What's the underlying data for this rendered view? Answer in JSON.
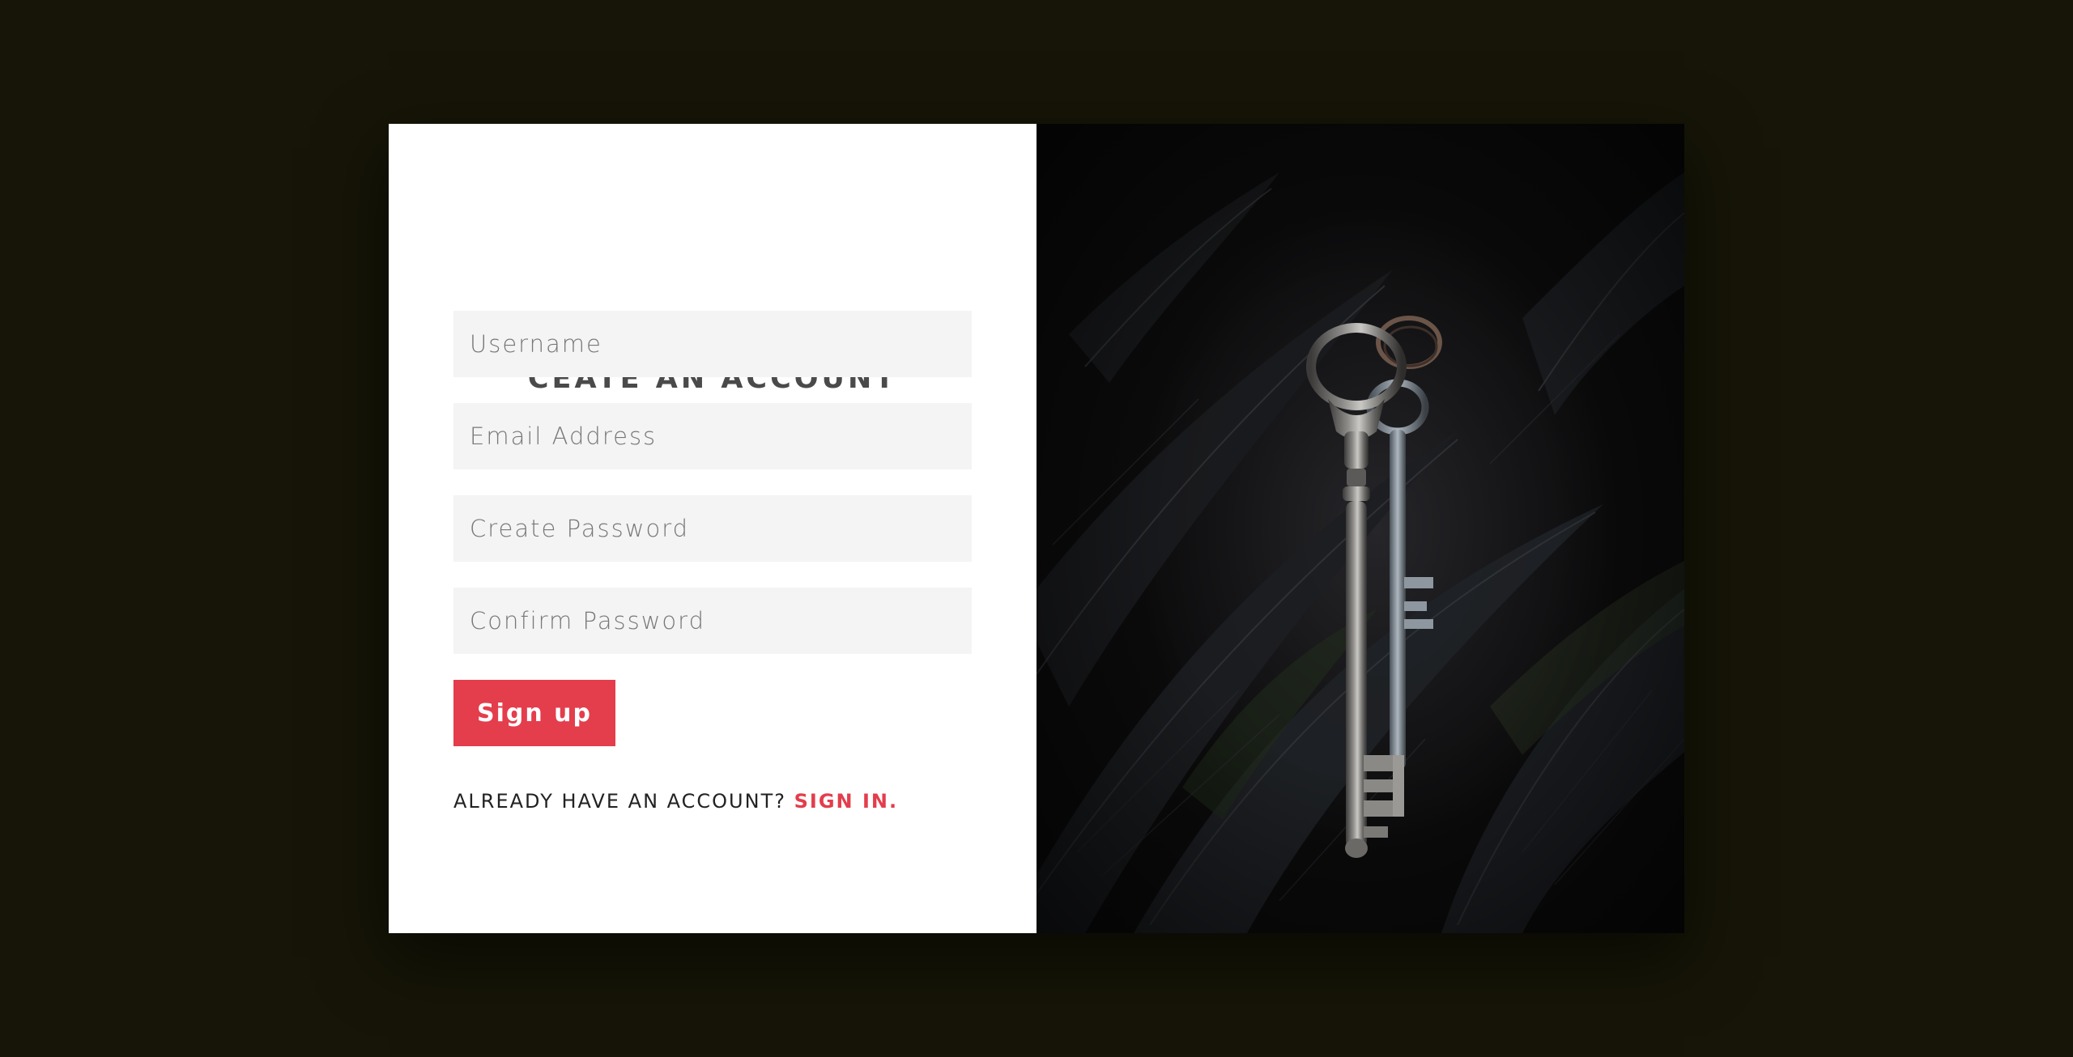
{
  "form": {
    "title": "CEATE AN ACCOUNT",
    "fields": [
      {
        "placeholder": "Username",
        "type": "text"
      },
      {
        "placeholder": "Email Address",
        "type": "email"
      },
      {
        "placeholder": "Create Password",
        "type": "password"
      },
      {
        "placeholder": "Confirm Password",
        "type": "password"
      }
    ],
    "submit_label": "Sign up",
    "signin_prompt": "ALREADY HAVE AN ACCOUNT?",
    "signin_link": "SIGN IN."
  },
  "image": {
    "subject": "keys-on-black-feathers"
  },
  "colors": {
    "page_background": "#161507",
    "panel_background": "#ffffff",
    "field_background": "#f4f4f4",
    "accent": "#e43d4c",
    "title_text": "#4a4a4a"
  }
}
